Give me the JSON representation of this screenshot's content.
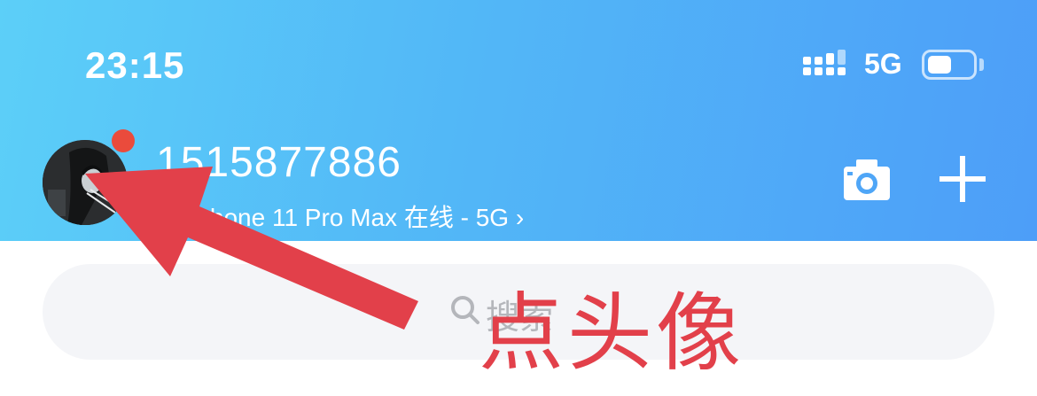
{
  "status_bar": {
    "time": "23:15",
    "network": "5G",
    "signal_icon": "signal-icon",
    "battery_icon": "battery-icon"
  },
  "header": {
    "account": "1515877886",
    "device_status": "iPhone 11 Pro Max 在线 - 5G ›",
    "camera_icon": "camera-icon",
    "add_icon": "plus-icon",
    "notification_dot_color": "#ea4b3c",
    "gradient": [
      "#5ccff8",
      "#4d9ef8"
    ]
  },
  "search": {
    "placeholder": "搜索",
    "icon": "search-icon"
  },
  "annotation": {
    "text": "点头像",
    "color": "#e2404a"
  }
}
